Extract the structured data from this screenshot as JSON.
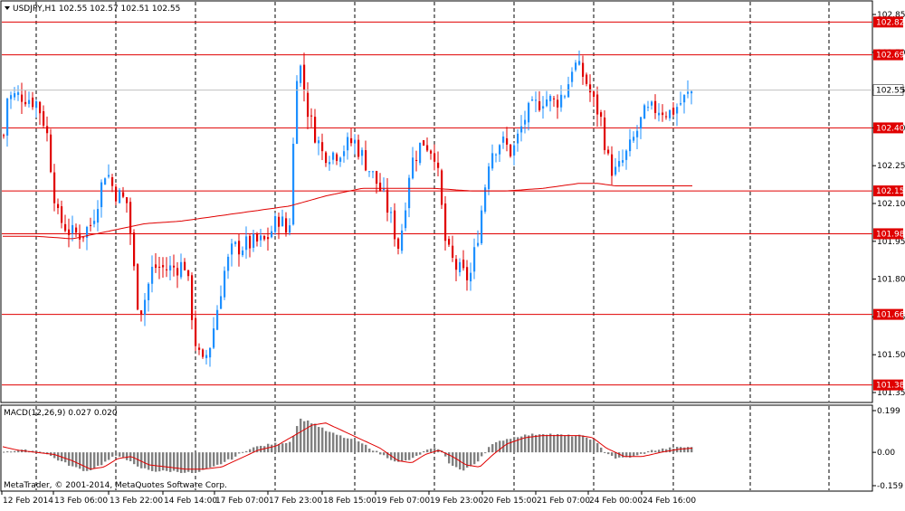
{
  "window": {
    "symbol_line": "USDJPY,H1  102.55 102.57 102.51 102.55",
    "macd_line": "MACD(12,26,9) 0.027 0.020",
    "copyright": "MetaTrader, © 2001-2014, MetaQuotes Software Corp."
  },
  "colors": {
    "bull": "#1e90ff",
    "bear": "#e00000",
    "ma": "#e00000",
    "level_line": "#e00000",
    "level_label_bg": "#e00000",
    "current_label_bg": "#ffffff",
    "histogram": "#808080",
    "signal": "#e00000",
    "grid": "#000000"
  },
  "chart_data": [
    {
      "type": "candlestick",
      "symbol": "USDJPY",
      "timeframe": "H1",
      "ylim": [
        101.35,
        102.85
      ],
      "y_ticks": [
        "102.85",
        "102.70",
        "102.55",
        "102.40",
        "102.25",
        "102.10",
        "101.95",
        "101.80",
        "101.65",
        "101.50",
        "101.35"
      ],
      "horizontal_levels": [
        102.82,
        102.69,
        102.4,
        102.15,
        101.98,
        101.66,
        101.38
      ],
      "level_labels": [
        "102.82",
        "102.69",
        "102.40",
        "102.15",
        "101.98",
        "101.66",
        "101.38"
      ],
      "current_price": 102.55,
      "current_price_label": "102.55",
      "x_tick_labels": [
        "12 Feb 2014",
        "13 Feb 06:00",
        "13 Feb 22:00",
        "14 Feb 14:00",
        "17 Feb 07:00",
        "17 Feb 23:00",
        "18 Feb 15:00",
        "19 Feb 07:00",
        "19 Feb 23:00",
        "20 Feb 15:00",
        "21 Feb 07:00",
        "24 Feb 00:00",
        "24 Feb 16:00"
      ],
      "price_path": [
        [
          0,
          102.22
        ],
        [
          6,
          102.52
        ],
        [
          24,
          102.53
        ],
        [
          40,
          102.5
        ],
        [
          50,
          102.4
        ],
        [
          62,
          102.05
        ],
        [
          78,
          101.98
        ],
        [
          90,
          101.98
        ],
        [
          100,
          102.02
        ],
        [
          116,
          102.24
        ],
        [
          125,
          102.15
        ],
        [
          140,
          102.1
        ],
        [
          150,
          101.72
        ],
        [
          156,
          101.68
        ],
        [
          168,
          101.85
        ],
        [
          185,
          101.84
        ],
        [
          204,
          101.86
        ],
        [
          215,
          101.55
        ],
        [
          222,
          101.45
        ],
        [
          232,
          101.55
        ],
        [
          246,
          101.82
        ],
        [
          256,
          101.92
        ],
        [
          275,
          101.94
        ],
        [
          292,
          101.95
        ],
        [
          308,
          102.05
        ],
        [
          318,
          101.96
        ],
        [
          328,
          102.7
        ],
        [
          340,
          102.45
        ],
        [
          355,
          102.3
        ],
        [
          370,
          102.3
        ],
        [
          390,
          102.35
        ],
        [
          405,
          102.25
        ],
        [
          420,
          102.15
        ],
        [
          430,
          102.05
        ],
        [
          440,
          101.92
        ],
        [
          452,
          102.25
        ],
        [
          466,
          102.35
        ],
        [
          480,
          102.3
        ],
        [
          492,
          101.92
        ],
        [
          502,
          101.85
        ],
        [
          510,
          101.82
        ],
        [
          518,
          101.8
        ],
        [
          528,
          102.0
        ],
        [
          540,
          102.3
        ],
        [
          552,
          102.35
        ],
        [
          565,
          102.3
        ],
        [
          580,
          102.45
        ],
        [
          600,
          102.52
        ],
        [
          612,
          102.5
        ],
        [
          625,
          102.55
        ],
        [
          632,
          102.66
        ],
        [
          645,
          102.6
        ],
        [
          655,
          102.5
        ],
        [
          662,
          102.45
        ],
        [
          672,
          102.25
        ],
        [
          680,
          102.22
        ],
        [
          695,
          102.32
        ],
        [
          710,
          102.45
        ],
        [
          725,
          102.48
        ],
        [
          740,
          102.46
        ],
        [
          765,
          102.55
        ]
      ],
      "ma_path": [
        [
          0,
          101.97
        ],
        [
          40,
          101.97
        ],
        [
          80,
          101.96
        ],
        [
          120,
          101.99
        ],
        [
          160,
          102.02
        ],
        [
          200,
          102.03
        ],
        [
          240,
          102.05
        ],
        [
          280,
          102.07
        ],
        [
          320,
          102.09
        ],
        [
          360,
          102.13
        ],
        [
          400,
          102.16
        ],
        [
          440,
          102.16
        ],
        [
          480,
          102.16
        ],
        [
          520,
          102.15
        ],
        [
          560,
          102.15
        ],
        [
          600,
          102.16
        ],
        [
          640,
          102.18
        ],
        [
          660,
          102.18
        ],
        [
          680,
          102.17
        ],
        [
          720,
          102.17
        ],
        [
          765,
          102.17
        ]
      ]
    },
    {
      "type": "bar",
      "name": "MACD(12,26,9)",
      "ylim": [
        -0.159,
        0.199
      ],
      "y_ticks": [
        "0.199",
        "0.00",
        "-0.159"
      ],
      "histogram_path": [
        [
          0,
          0.005
        ],
        [
          30,
          0.01
        ],
        [
          45,
          0.005
        ],
        [
          60,
          -0.03
        ],
        [
          80,
          -0.07
        ],
        [
          95,
          -0.09
        ],
        [
          110,
          -0.06
        ],
        [
          125,
          -0.02
        ],
        [
          135,
          -0.02
        ],
        [
          150,
          -0.07
        ],
        [
          170,
          -0.09
        ],
        [
          190,
          -0.09
        ],
        [
          215,
          -0.1
        ],
        [
          235,
          -0.07
        ],
        [
          255,
          -0.03
        ],
        [
          275,
          0.02
        ],
        [
          300,
          0.04
        ],
        [
          320,
          0.05
        ],
        [
          330,
          0.16
        ],
        [
          345,
          0.14
        ],
        [
          360,
          0.1
        ],
        [
          380,
          0.07
        ],
        [
          400,
          0.04
        ],
        [
          420,
          -0.01
        ],
        [
          440,
          -0.05
        ],
        [
          455,
          -0.03
        ],
        [
          470,
          0.01
        ],
        [
          485,
          0.02
        ],
        [
          495,
          -0.05
        ],
        [
          510,
          -0.09
        ],
        [
          525,
          -0.05
        ],
        [
          540,
          0.03
        ],
        [
          555,
          0.06
        ],
        [
          575,
          0.08
        ],
        [
          600,
          0.09
        ],
        [
          625,
          0.08
        ],
        [
          640,
          0.08
        ],
        [
          655,
          0.06
        ],
        [
          665,
          0.01
        ],
        [
          680,
          -0.03
        ],
        [
          700,
          -0.02
        ],
        [
          720,
          0.01
        ],
        [
          740,
          0.02
        ],
        [
          765,
          0.027
        ]
      ],
      "signal_path": [
        [
          0,
          0.03
        ],
        [
          20,
          0.01
        ],
        [
          40,
          0.0
        ],
        [
          60,
          -0.01
        ],
        [
          80,
          -0.04
        ],
        [
          100,
          -0.08
        ],
        [
          115,
          -0.07
        ],
        [
          130,
          -0.03
        ],
        [
          145,
          -0.02
        ],
        [
          165,
          -0.06
        ],
        [
          185,
          -0.07
        ],
        [
          205,
          -0.08
        ],
        [
          225,
          -0.08
        ],
        [
          245,
          -0.07
        ],
        [
          265,
          -0.03
        ],
        [
          285,
          0.01
        ],
        [
          305,
          0.03
        ],
        [
          325,
          0.08
        ],
        [
          345,
          0.13
        ],
        [
          360,
          0.14
        ],
        [
          380,
          0.1
        ],
        [
          400,
          0.06
        ],
        [
          420,
          0.02
        ],
        [
          440,
          -0.04
        ],
        [
          455,
          -0.05
        ],
        [
          470,
          -0.01
        ],
        [
          485,
          0.01
        ],
        [
          500,
          -0.02
        ],
        [
          515,
          -0.06
        ],
        [
          530,
          -0.07
        ],
        [
          545,
          -0.01
        ],
        [
          560,
          0.04
        ],
        [
          580,
          0.07
        ],
        [
          600,
          0.08
        ],
        [
          620,
          0.08
        ],
        [
          640,
          0.08
        ],
        [
          655,
          0.07
        ],
        [
          670,
          0.02
        ],
        [
          690,
          -0.02
        ],
        [
          710,
          -0.02
        ],
        [
          730,
          0.0
        ],
        [
          750,
          0.015
        ],
        [
          765,
          0.02
        ]
      ],
      "signal_current": 0.02,
      "macd_current": 0.027
    }
  ]
}
